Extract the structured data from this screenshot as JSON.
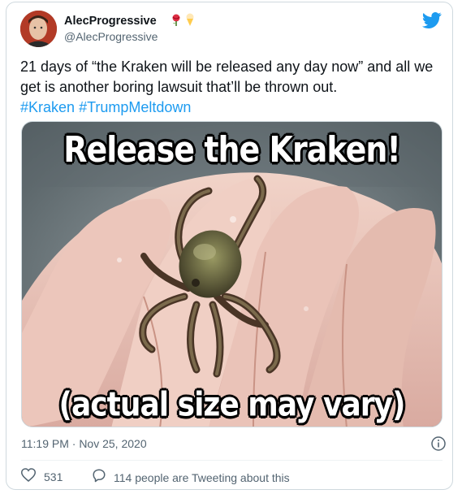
{
  "author": {
    "name": "AlecProgressive",
    "handle": "@AlecProgressive",
    "name_emoji": [
      "rose-icon",
      "ice-cream-icon"
    ]
  },
  "tweet": {
    "text_plain": "21 days of “the Kraken will be released any day now” and all we get is another boring lawsuit that’ll be thrown out.",
    "hashtags": [
      "#Kraken",
      "#TrumpMeltdown"
    ]
  },
  "media": {
    "caption_top": "Release the Kraken!",
    "caption_bottom": "(actual size may vary)"
  },
  "meta": {
    "timestamp": "11:19 PM · Nov 25, 2020"
  },
  "engagement": {
    "likes": "531",
    "conversation": "114 people are Tweeting about this"
  },
  "colors": {
    "accent": "#1d9bf0",
    "secondary_text": "#536471",
    "border": "#cfd9de",
    "like_icon": "#536471"
  }
}
